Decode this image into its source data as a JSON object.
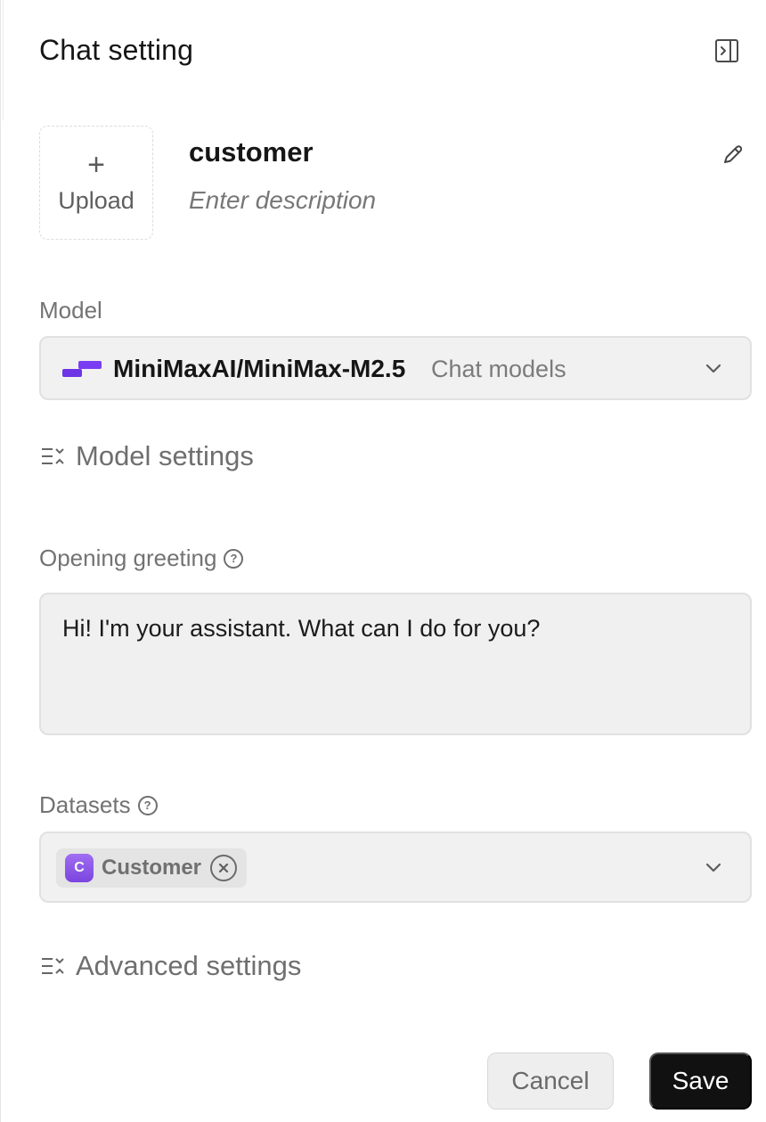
{
  "header": {
    "title": "Chat setting",
    "collapse_icon": "panel-collapse-icon"
  },
  "assistant": {
    "upload_icon": "plus-icon",
    "upload_label": "Upload",
    "name": "customer",
    "description_placeholder": "Enter description",
    "edit_icon": "pencil-icon"
  },
  "model": {
    "label": "Model",
    "selected_name": "MiniMaxAI/MiniMax-M2.5",
    "selected_type": "Chat models",
    "logo_color": "#6d35e6",
    "dropdown_icon": "chevron-down-icon",
    "settings_label": "Model settings"
  },
  "opening_greeting": {
    "label": "Opening greeting",
    "help_icon": "question-circle-icon",
    "value": "Hi! I'm your assistant. What can I do for you?"
  },
  "datasets": {
    "label": "Datasets",
    "help_icon": "question-circle-icon",
    "selected": [
      {
        "initial": "C",
        "name": "Customer",
        "avatar_color": "#8a57e8"
      }
    ],
    "dropdown_icon": "chevron-down-icon"
  },
  "advanced_settings": {
    "label": "Advanced settings"
  },
  "footer": {
    "cancel_label": "Cancel",
    "save_label": "Save",
    "save_color": "#111111"
  }
}
